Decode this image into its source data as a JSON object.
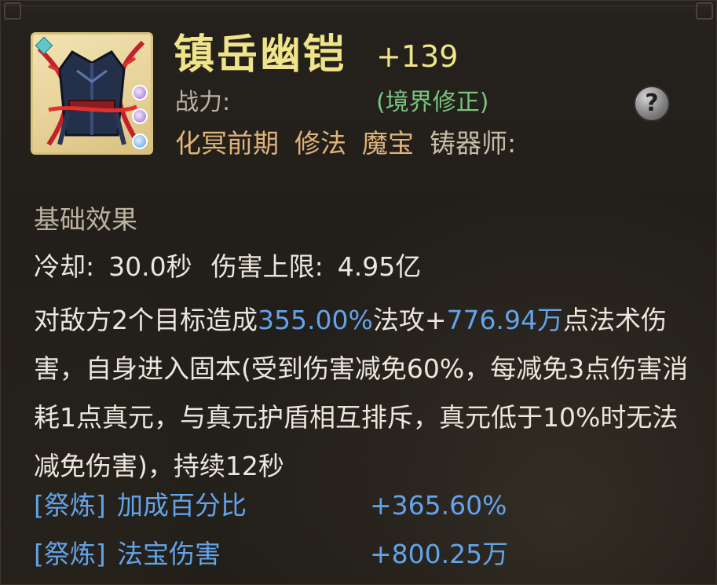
{
  "item": {
    "name": "镇岳幽铠",
    "enhance_level": "+139",
    "icon": "armor-icon",
    "power_label": "战力:",
    "realm_note": "(境界修正)",
    "help_label": "?",
    "tags": [
      "化冥前期",
      "修法",
      "魔宝",
      "铸器师:"
    ]
  },
  "effects": {
    "section_title": "基础效果",
    "cooldown_label": "冷却:",
    "cooldown_value": "30.0秒",
    "damage_cap_label": "伤害上限:",
    "damage_cap_value": "4.95亿",
    "description_parts": [
      {
        "text": "对敌方2个目标造成",
        "highlight": false
      },
      {
        "text": "355.00%",
        "highlight": true
      },
      {
        "text": "法攻+",
        "highlight": false
      },
      {
        "text": "776.94万",
        "highlight": true
      },
      {
        "text": "点法术伤害，自身进入固本(受到伤害减免60%，每减免3点伤害消耗1点真元，与真元护盾相互排斥，真元低于10%时无法减免伤害)，持续12秒",
        "highlight": false
      }
    ]
  },
  "refinements": [
    {
      "tag": "[祭炼]",
      "name": "加成百分比",
      "value": "+365.60%"
    },
    {
      "tag": "[祭炼]",
      "name": "法宝伤害",
      "value": "+800.25万"
    }
  ],
  "colors": {
    "title": "#f0e48a",
    "realm": "#79c57f",
    "tag": "#dfb37a",
    "highlight": "#63a3ea",
    "body": "#ece7dc",
    "label": "#bcb39f"
  }
}
